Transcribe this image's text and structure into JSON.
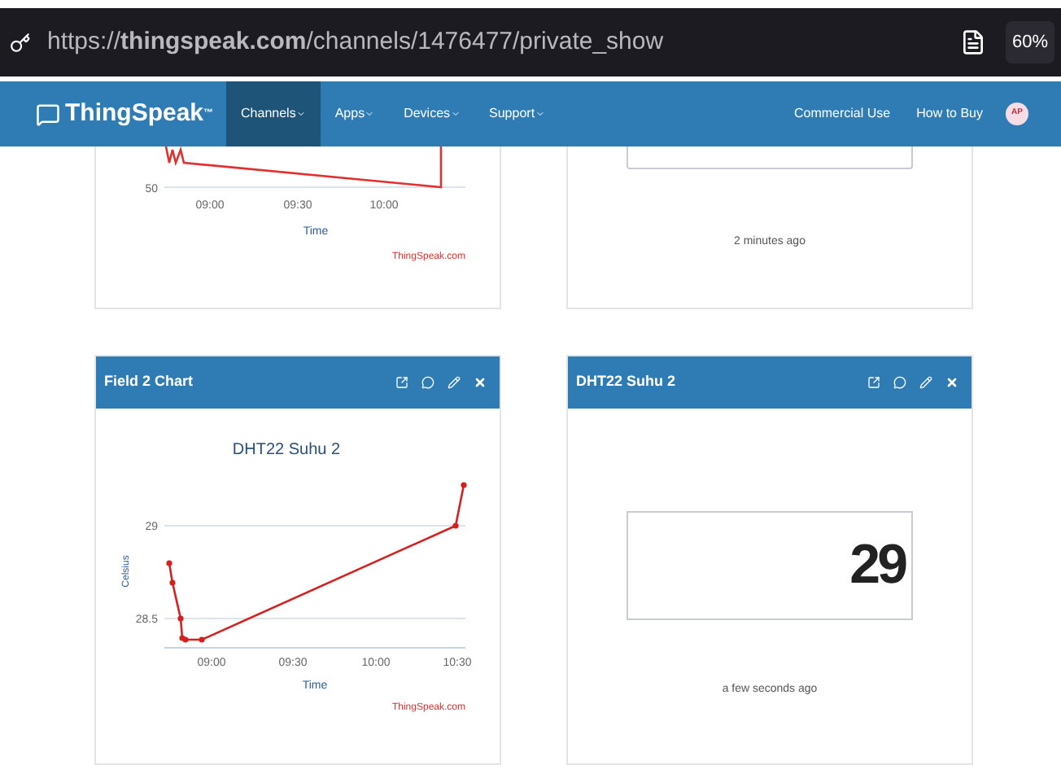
{
  "browser": {
    "url": "https://**thingspeak.com**/channels/1476477/private_show",
    "zoom": "60%"
  },
  "nav": {
    "logo": "ThingSpeak",
    "trademark": "™",
    "menus": [
      {
        "label": "Channels",
        "selected": true
      },
      {
        "label": "Apps",
        "selected": false
      },
      {
        "label": "Devices",
        "selected": false
      },
      {
        "label": "Support",
        "selected": false
      }
    ],
    "links": [
      "Commercial Use",
      "How to Buy"
    ],
    "avatar": "AP"
  },
  "widgets": [
    {
      "kind": "chart_partial",
      "y_tick": "50",
      "x_ticks": [
        "09:00",
        "09:30",
        "10:00"
      ],
      "xlabel": "Time",
      "credit": "ThingSpeak.com"
    },
    {
      "kind": "value_partial",
      "timestamp": "2 minutes ago"
    },
    {
      "kind": "chart",
      "title": "Field 2 Chart",
      "credit": "ThingSpeak.com",
      "chart": {
        "title": "DHT22 Suhu 2",
        "xlabel": "Time",
        "ylabel": "Celsius",
        "x_ticks": [
          "09:00",
          "09:30",
          "10:00",
          "10:30"
        ],
        "y_ticks": [
          "29",
          "28.5"
        ]
      }
    },
    {
      "kind": "value",
      "title": "DHT22 Suhu 2",
      "value": "29",
      "timestamp": "a few seconds ago"
    }
  ]
}
